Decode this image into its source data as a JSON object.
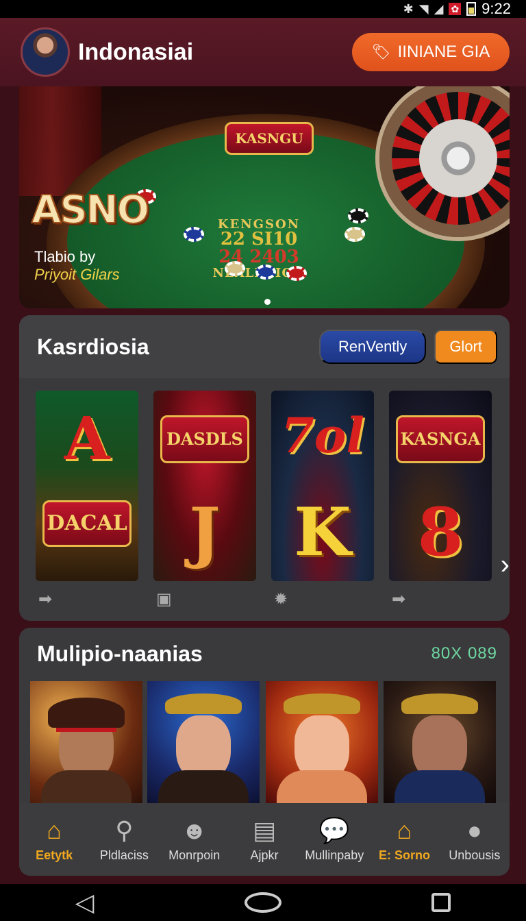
{
  "status_bar": {
    "time": "9:22"
  },
  "header": {
    "title": "Indonasiai",
    "cta_label": "IINIANE GIA"
  },
  "hero": {
    "title": "ASNO",
    "logo_text": "KASNGU",
    "felt_lines": [
      "KENGSON",
      "22 SI10",
      "24 2403",
      "NEALDSION"
    ],
    "subtitle_1": "Tlabio by",
    "subtitle_2": "Priyoit Gilars"
  },
  "casino_section": {
    "title": "Kasrdiosia",
    "button_blue": "RenVently",
    "button_orange": "Glort",
    "games": [
      {
        "top": "A",
        "badge": "DACAL",
        "icon": "chat-arrow-icon"
      },
      {
        "top": "DASDLS",
        "badge": "J",
        "icon": "slot-machine-icon"
      },
      {
        "top": "7ol",
        "badge": "K",
        "icon": "gear-icon"
      },
      {
        "top": "KASNGA",
        "badge": "8",
        "icon": "chat-arrow-icon"
      }
    ]
  },
  "multi_section": {
    "title": "Mulipio-naanias",
    "meta": "80X 089"
  },
  "bottom_nav": [
    {
      "label": "Eetytk",
      "active": true
    },
    {
      "label": "Pldlaciss",
      "active": false
    },
    {
      "label": "Monrpoin",
      "active": false
    },
    {
      "label": "Ajpkr",
      "active": false
    },
    {
      "label": "Mullinpaby",
      "active": false
    },
    {
      "label": "E: Sorno",
      "active": true
    },
    {
      "label": "Unbousis",
      "active": false
    }
  ],
  "colors": {
    "accent": "#f0a81e",
    "cta": "#e85a20",
    "background": "#3a0f18"
  }
}
